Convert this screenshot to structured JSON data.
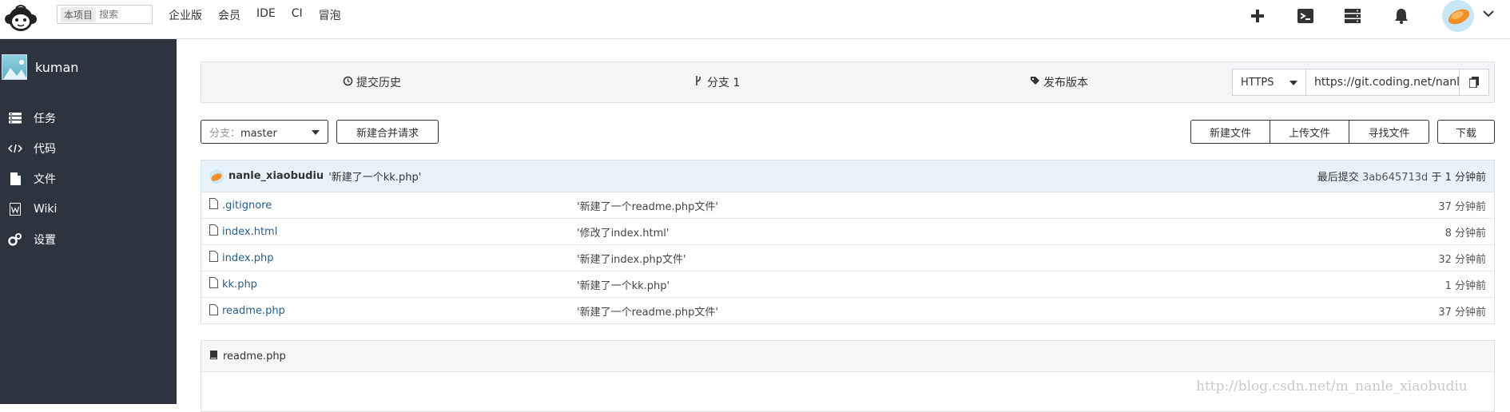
{
  "topbar": {
    "search_scope": "本项目",
    "search_placeholder": "搜索",
    "nav": [
      "企业版",
      "会员",
      "IDE",
      "CI",
      "冒泡"
    ]
  },
  "sidebar": {
    "project_name": "kuman",
    "items": [
      {
        "label": "任务",
        "icon": "tasks-icon"
      },
      {
        "label": "代码",
        "icon": "code-icon"
      },
      {
        "label": "文件",
        "icon": "file-icon"
      },
      {
        "label": "Wiki",
        "icon": "wiki-icon"
      },
      {
        "label": "设置",
        "icon": "gears-icon"
      }
    ]
  },
  "repo": {
    "tabs": {
      "history": "提交历史",
      "branches": "分支 1",
      "releases": "发布版本"
    },
    "clone": {
      "protocol": "HTTPS",
      "url": "https://git.coding.net/nanle_xiaobudiu/kuman.git"
    },
    "branch_label": "分支：",
    "branch_value": "master",
    "new_merge_request": "新建合并请求",
    "new_file": "新建文件",
    "upload_file": "上传文件",
    "find_file": "寻找文件",
    "download": "下载"
  },
  "latest_commit": {
    "user": "nanle_xiaobudiu",
    "message": "'新建了一个kk.php'",
    "label": "最后提交",
    "hash": "3ab645713d",
    "time": "于 1 分钟前"
  },
  "files": [
    {
      "name": ".gitignore",
      "message": "'新建了一个readme.php文件'",
      "time": "37 分钟前"
    },
    {
      "name": "index.html",
      "message": "'修改了index.html'",
      "time": "8 分钟前"
    },
    {
      "name": "index.php",
      "message": "'新建了index.php文件'",
      "time": "32 分钟前"
    },
    {
      "name": "kk.php",
      "message": "'新建了一个kk.php'",
      "time": "1 分钟前"
    },
    {
      "name": "readme.php",
      "message": "'新建了一个readme.php文件'",
      "time": "37 分钟前"
    }
  ],
  "readme": {
    "title": "readme.php"
  },
  "watermark": "http://blog.csdn.net/m_nanle_xiaobudiu",
  "colors": {
    "sidebar_bg": "#2d3440",
    "commit_row_bg": "#e8f2fb",
    "link": "#2a5d8a"
  }
}
